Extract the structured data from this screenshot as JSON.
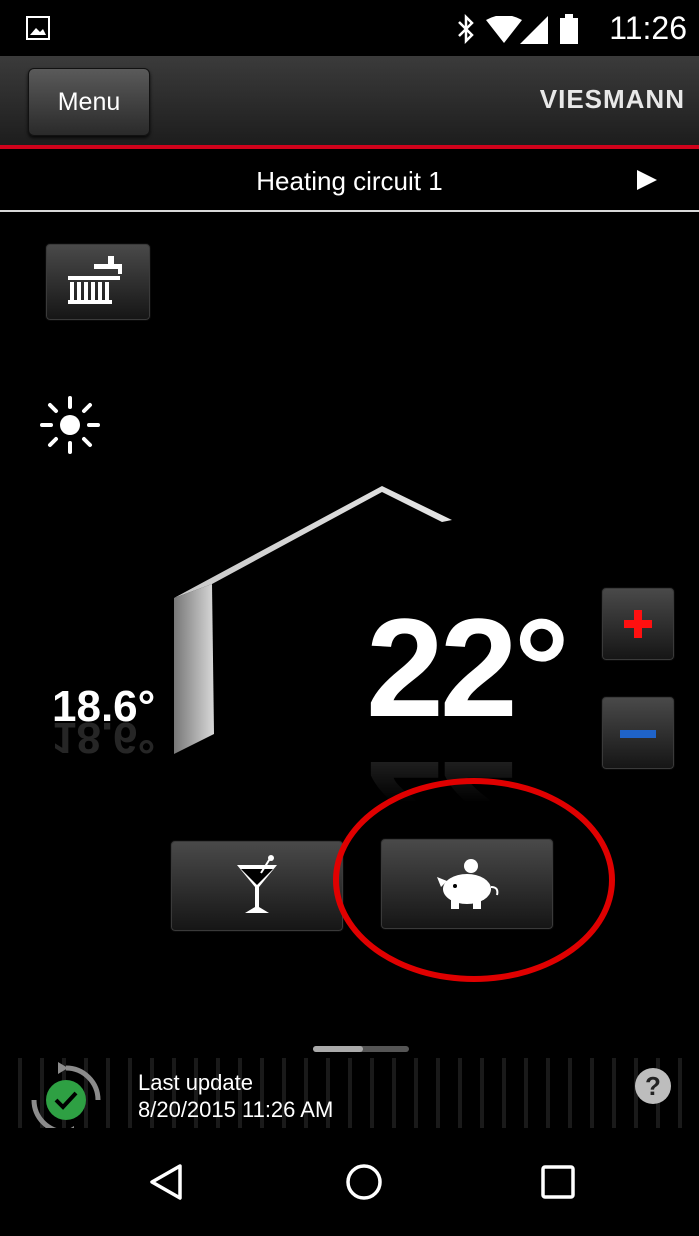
{
  "status_bar": {
    "time": "11:26",
    "icons": [
      "image-icon",
      "bluetooth-icon",
      "wifi-icon",
      "signal-icon",
      "battery-icon"
    ]
  },
  "header": {
    "menu_label": "Menu",
    "logo_text": "VIESMANN"
  },
  "circuit": {
    "title": "Heating circuit 1"
  },
  "thermostat": {
    "current_temp": "18.6°",
    "set_temp": "22°"
  },
  "buttons": {
    "dhw": "tap-radiator-icon",
    "plus": "plus-icon",
    "minus": "minus-icon",
    "party": "cocktail-icon",
    "eco": "piggy-bank-icon"
  },
  "footer": {
    "label": "Last update",
    "value": "8/20/2015 11:26 AM",
    "help": "?"
  },
  "colors": {
    "accent_red": "#d0021b",
    "plus_red": "#ff1010",
    "minus_blue": "#1f63c8",
    "ok_green": "#2ea043",
    "annotation_red": "#e00000"
  }
}
